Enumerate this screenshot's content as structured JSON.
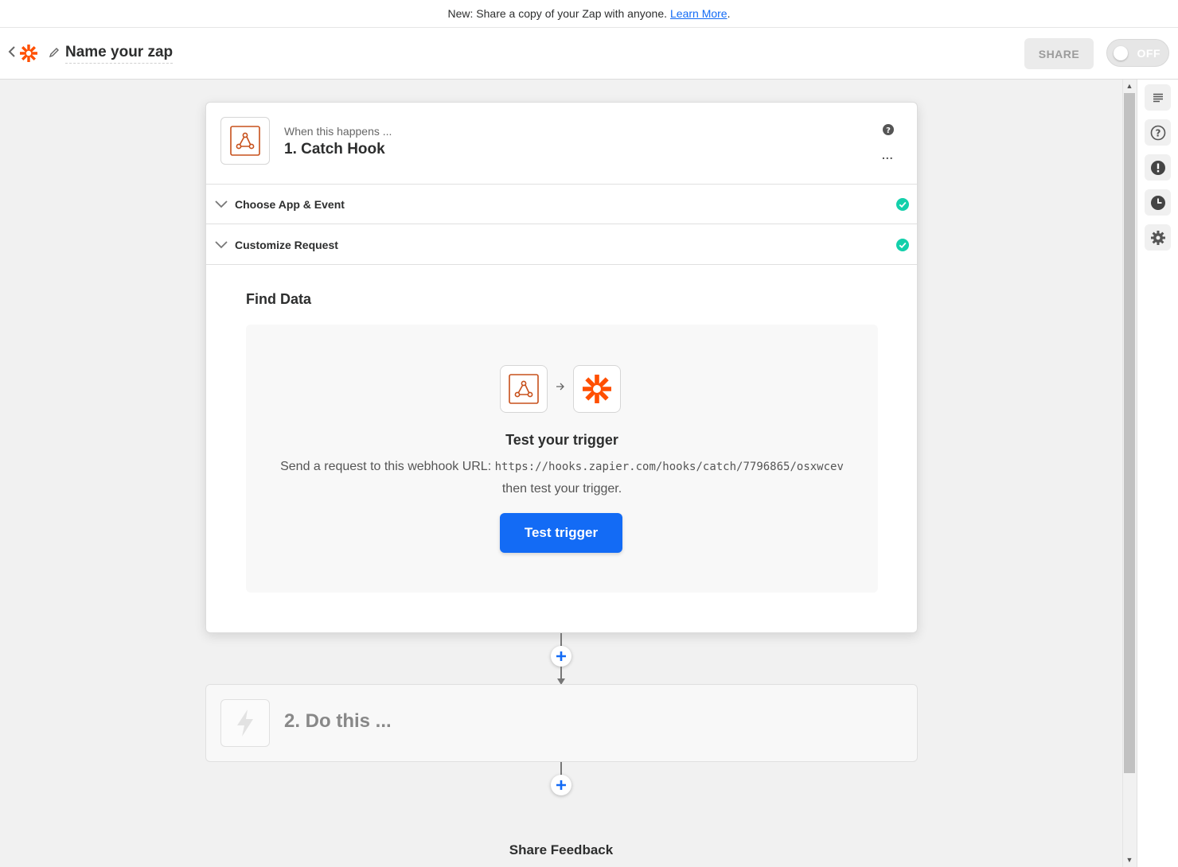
{
  "announcement": {
    "text": "New: Share a copy of your Zap with anyone.",
    "link_label": "Learn More",
    "trailing": "."
  },
  "header": {
    "zap_name": "Name your zap",
    "share_label": "SHARE",
    "toggle_label": "OFF"
  },
  "step1": {
    "pretitle": "When this happens ...",
    "title": "1. Catch Hook",
    "more_label": "...",
    "sections": [
      {
        "label": "Choose App & Event",
        "status": "complete"
      },
      {
        "label": "Customize Request",
        "status": "complete"
      }
    ],
    "find_data_heading": "Find Data",
    "test_title": "Test your trigger",
    "test_desc_before": "Send a request to this webhook URL:",
    "webhook_url": "https://hooks.zapier.com/hooks/catch/7796865/osxwcev",
    "test_desc_after": "then test your trigger.",
    "test_button_label": "Test trigger"
  },
  "step2": {
    "title": "2. Do this ..."
  },
  "feedback_label": "Share Feedback",
  "right_rail": [
    "outline-icon",
    "help-icon",
    "alert-icon",
    "history-icon",
    "settings-icon"
  ],
  "colors": {
    "accent_blue": "#136bf5",
    "zapier_orange": "#ff4f00",
    "webhook_orange": "#c7501b",
    "success_green": "#13d0ab"
  }
}
